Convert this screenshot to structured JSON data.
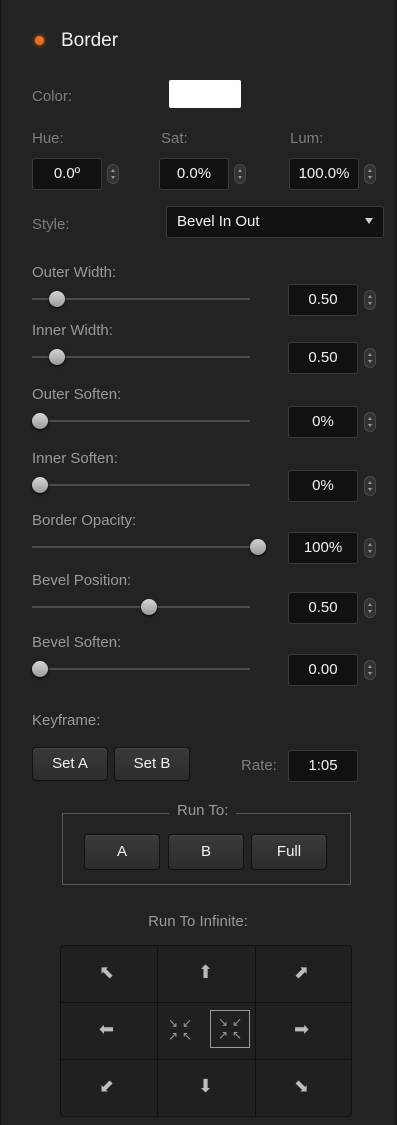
{
  "header": {
    "title": "Border",
    "indicator_color": "#e8731f"
  },
  "color": {
    "label": "Color:",
    "swatch": "#ffffff"
  },
  "hsl": {
    "hue": {
      "label": "Hue:",
      "value": "0.0º"
    },
    "sat": {
      "label": "Sat:",
      "value": "0.0%"
    },
    "lum": {
      "label": "Lum:",
      "value": "100.0%"
    }
  },
  "style": {
    "label": "Style:",
    "selected": "Bevel In Out"
  },
  "sliders": [
    {
      "label": "Outer Width:",
      "value": "0.50",
      "level": 0.08
    },
    {
      "label": "Inner Width:",
      "value": "0.50",
      "level": 0.08
    },
    {
      "label": "Outer Soften:",
      "value": "0%",
      "level": 0.0
    },
    {
      "label": "Inner Soften:",
      "value": "0%",
      "level": 0.0
    },
    {
      "label": "Border Opacity:",
      "value": "100%",
      "level": 1.0
    },
    {
      "label": "Bevel Position:",
      "value": "0.50",
      "level": 0.5
    },
    {
      "label": "Bevel Soften:",
      "value": "0.00",
      "level": 0.0
    }
  ],
  "keyframe": {
    "label": "Keyframe:",
    "set_a": "Set A",
    "set_b": "Set B",
    "rate_label": "Rate:",
    "rate_value": "1:05"
  },
  "run_to": {
    "label": "Run To:",
    "a": "A",
    "b": "B",
    "full": "Full"
  },
  "run_to_infinite": {
    "label": "Run To Infinite:",
    "arrows": {
      "top_left": "⬉",
      "top": "⬆",
      "top_right": "⬈",
      "left": "⬅",
      "right": "➡",
      "bottom_left": "⬋",
      "bottom": "⬇",
      "bottom_right": "⬊"
    },
    "center_glyphs": [
      "↘",
      "↙",
      "↗",
      "↖"
    ]
  }
}
